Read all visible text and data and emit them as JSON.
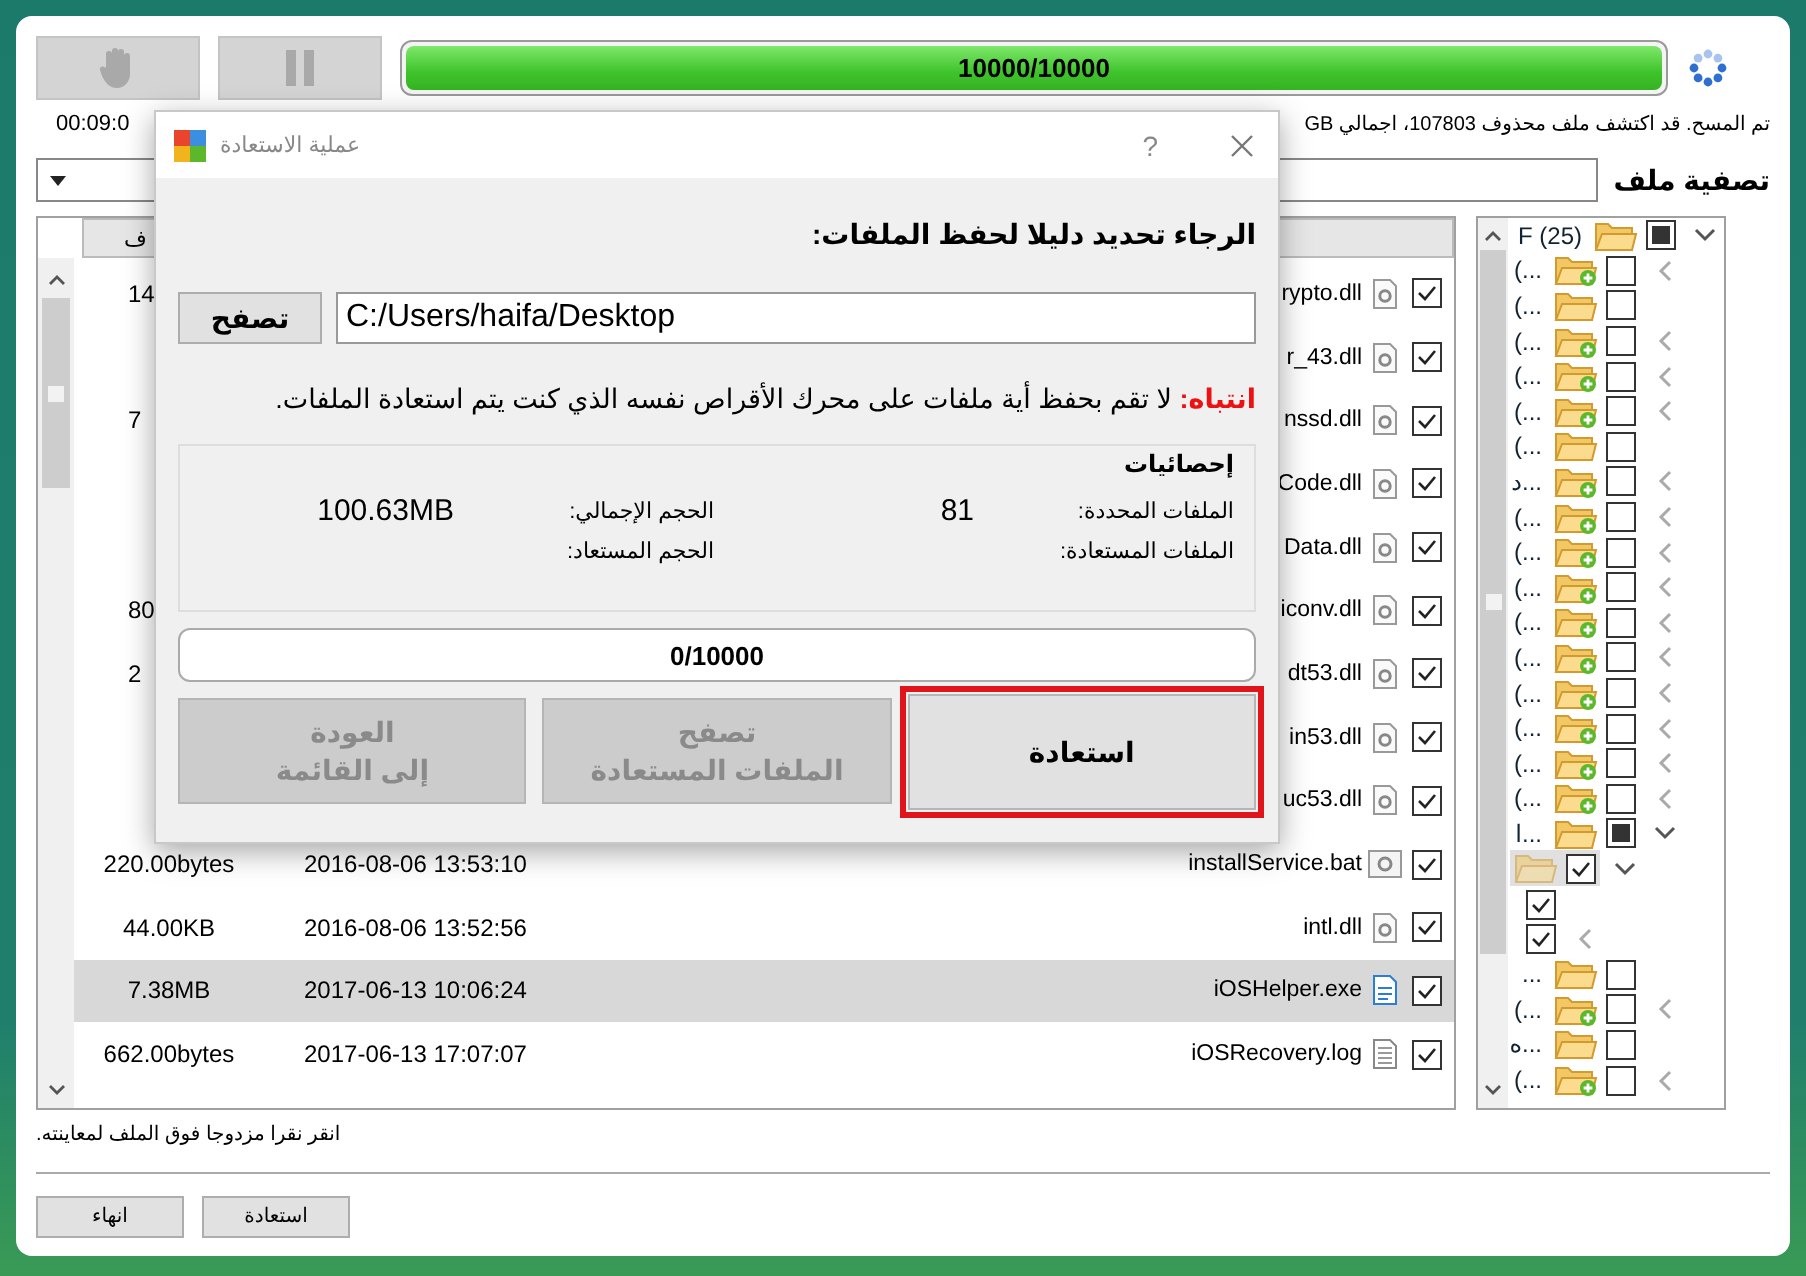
{
  "progress": {
    "label": "10000/10000",
    "level": 1
  },
  "status": {
    "elapsed": "00:09:0",
    "message": "تم المسح. قد اكتشف ملف محذوف 107803، اجمالي GB"
  },
  "filter": {
    "label": "تصفية ملف"
  },
  "table": {
    "header": "ف",
    "rows": [
      {
        "size": "14",
        "cut": true,
        "name": "rypto.dll",
        "kind": "dll",
        "checked": true,
        "selected": false
      },
      {
        "cut": true,
        "name": "r_43.dll",
        "kind": "dll",
        "checked": true,
        "selected": false
      },
      {
        "size": "7",
        "cut": true,
        "name": "nssd.dll",
        "kind": "dll",
        "checked": true,
        "selected": false
      },
      {
        "cut": true,
        "name": "Code.dll",
        "kind": "dll",
        "checked": true,
        "selected": false
      },
      {
        "cut": true,
        "name": "Data.dll",
        "kind": "dll",
        "checked": true,
        "selected": false
      },
      {
        "size": "80",
        "cut": true,
        "name": "iconv.dll",
        "kind": "dll",
        "checked": true,
        "selected": false
      },
      {
        "size": "2",
        "cut": true,
        "name": "dt53.dll",
        "kind": "dll",
        "checked": true,
        "selected": false
      },
      {
        "cut": true,
        "name": "in53.dll",
        "kind": "dll",
        "checked": true,
        "selected": false
      },
      {
        "cut": true,
        "name": "uc53.dll",
        "kind": "dll",
        "checked": true,
        "selected": false
      },
      {
        "size": "220.00bytes",
        "cut": false,
        "date": "2016-08-06 13:53:10",
        "name": "installService.bat",
        "kind": "bat",
        "checked": true,
        "selected": false
      },
      {
        "size": "44.00KB",
        "cut": false,
        "date": "2016-08-06 13:52:56",
        "name": "intl.dll",
        "kind": "dll",
        "checked": true,
        "selected": false
      },
      {
        "size": "7.38MB",
        "cut": false,
        "date": "2017-06-13 10:06:24",
        "name": "iOSHelper.exe",
        "kind": "exe",
        "checked": true,
        "selected": true
      },
      {
        "size": "662.00bytes",
        "cut": false,
        "date": "2017-06-13 17:07:07",
        "name": "iOSRecovery.log",
        "kind": "log",
        "checked": true,
        "selected": false
      }
    ]
  },
  "tree": {
    "label": "F (25)",
    "kind": "folder",
    "checked": false,
    "mixed": true,
    "expanded": true,
    "selected": false,
    "children": [
      {
        "label": "(...",
        "kind": "newfolder",
        "checked": false,
        "mixed": false,
        "expanded": false,
        "selected": false
      },
      {
        "label": "(...",
        "kind": "folder",
        "checked": false,
        "mixed": false,
        "selected": false
      },
      {
        "label": "(...",
        "kind": "newfolder",
        "checked": false,
        "mixed": false,
        "expanded": false,
        "selected": false
      },
      {
        "label": "(...",
        "kind": "newfolder",
        "checked": false,
        "mixed": false,
        "expanded": false,
        "selected": false
      },
      {
        "label": "(...",
        "kind": "newfolder",
        "checked": false,
        "mixed": false,
        "expanded": false,
        "selected": false
      },
      {
        "label": "(...",
        "kind": "folder",
        "checked": false,
        "mixed": false,
        "selected": false
      },
      {
        "label": "د...",
        "kind": "newfolder",
        "checked": false,
        "mixed": false,
        "expanded": false,
        "selected": false
      },
      {
        "label": "(...",
        "kind": "newfolder",
        "checked": false,
        "mixed": false,
        "expanded": false,
        "selected": false
      },
      {
        "label": "(...",
        "kind": "newfolder",
        "checked": false,
        "mixed": false,
        "expanded": false,
        "selected": false
      },
      {
        "label": "(...",
        "kind": "newfolder",
        "checked": false,
        "mixed": false,
        "expanded": false,
        "selected": false
      },
      {
        "label": "(...",
        "kind": "newfolder",
        "checked": false,
        "mixed": false,
        "expanded": false,
        "selected": false
      },
      {
        "label": "(...",
        "kind": "newfolder",
        "checked": false,
        "mixed": false,
        "expanded": false,
        "selected": false
      },
      {
        "label": "(...",
        "kind": "newfolder",
        "checked": false,
        "mixed": false,
        "expanded": false,
        "selected": false
      },
      {
        "label": "(...",
        "kind": "newfolder",
        "checked": false,
        "mixed": false,
        "expanded": false,
        "selected": false
      },
      {
        "label": "(...",
        "kind": "newfolder",
        "checked": false,
        "mixed": false,
        "expanded": false,
        "selected": false
      },
      {
        "label": "(...",
        "kind": "newfolder",
        "checked": false,
        "mixed": false,
        "expanded": false,
        "selected": false
      },
      {
        "label": "ا...",
        "kind": "folder",
        "checked": false,
        "mixed": true,
        "expanded": true,
        "selected": false,
        "children": [
          {
            "kind": "folder",
            "checked": true,
            "expanded": true,
            "selected": true,
            "children": [
              {
                "checked": true,
                "selected": false
              },
              {
                "checked": true,
                "expanded": false,
                "selected": false
              }
            ]
          }
        ]
      },
      {
        "label": "...",
        "kind": "folder",
        "checked": false,
        "mixed": false,
        "selected": false
      },
      {
        "label": "(...",
        "kind": "newfolder",
        "checked": false,
        "mixed": false,
        "expanded": false,
        "selected": false
      },
      {
        "label": "ه...",
        "kind": "folder",
        "checked": false,
        "mixed": false,
        "selected": false
      },
      {
        "label": "(...",
        "kind": "newfolder",
        "checked": false,
        "mixed": false,
        "expanded": false,
        "selected": false
      }
    ]
  },
  "hint": "انقر نقرا مزدوجا فوق الملف لمعاينته.",
  "footer_buttons": [
    {
      "label": "استعادة"
    },
    {
      "label": "انهاء"
    }
  ],
  "dialog": {
    "title": "عملية الاستعادة",
    "help": "?",
    "prompt": "الرجاء تحديد دليلا لحفظ الملفات:",
    "browse": "تصفح",
    "path": "C:/Users/haifa/Desktop",
    "warning": "**انتباه:** لا تقم بحفظ أية ملفات على محرك الأقراص نفسه الذي كنت يتم استعادة الملفات.",
    "stats": {
      "title": "إحصائيات",
      "items": [
        {
          "label": "الملفات المحددة:",
          "value": "81"
        },
        {
          "label": "الحجم الإجمالي:",
          "value": "100.63MB"
        },
        {
          "label": "الملفات المستعادة:"
        },
        {
          "label": "الحجم المستعاد:"
        }
      ]
    },
    "progress": {
      "label": "0/10000",
      "level": 0
    },
    "buttons": [
      {
        "lines": [
          "استعادة"
        ],
        "disabled": false,
        "highlighted": true
      },
      {
        "lines": [
          "تصفح",
          "الملفات المستعادة"
        ],
        "disabled": true,
        "highlighted": false
      },
      {
        "lines": [
          "العودة",
          "إلى القائمة"
        ],
        "disabled": true,
        "highlighted": false
      }
    ]
  }
}
